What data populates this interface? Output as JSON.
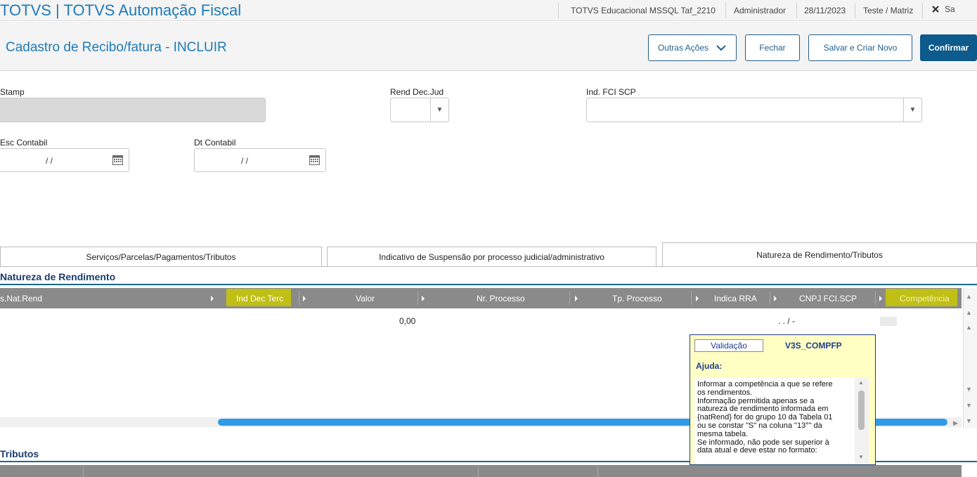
{
  "topbar": {
    "app_title": "TOTVS | TOTVS Automação Fiscal",
    "environment": "TOTVS Educacional MSSQL Taf_2210",
    "user": "Administrador",
    "date": "28/11/2023",
    "branch": "Teste / Matriz",
    "exit_label": "Sa"
  },
  "header": {
    "title": "Cadastro de Recibo/fatura - INCLUIR",
    "buttons": {
      "more_actions": "Outras Ações",
      "close": "Fechar",
      "save_new": "Salvar e Criar Novo",
      "confirm": "Confirmar"
    }
  },
  "form": {
    "stamp_label": "Stamp",
    "rend_dec_jud_label": "Rend Dec.Jud",
    "ind_fci_scp_label": "Ind. FCI SCP",
    "esc_contabil_label": "Esc Contabil",
    "esc_contabil_value": "/ /",
    "dt_contabil_label": "Dt Contabil",
    "dt_contabil_value": "/ /"
  },
  "tabs": [
    {
      "label": "Serviços/Parcelas/Pagamentos/Tributos",
      "active": false
    },
    {
      "label": "Indicativo de Suspensão por processo judicial/administrativo",
      "active": false
    },
    {
      "label": "Natureza de Rendimento/Tributos",
      "active": true
    }
  ],
  "natureza": {
    "title": "Natureza de Rendimento",
    "columns": [
      "s.Nat.Rend",
      "Ind Dec Terc",
      "Valor",
      "Nr. Processo",
      "Tp. Processo",
      "Indica RRA",
      "CNPJ FCI.SCP",
      "Competência"
    ],
    "row": {
      "valor": "0,00",
      "cnpj": ".  .  /  -"
    }
  },
  "tributos": {
    "title": "Tributos"
  },
  "tooltip": {
    "button": "Validação",
    "code": "V3S_COMPFP",
    "help_label": "Ajuda:",
    "text": "Informar a competência a que se refere\nos rendimentos.\nInformação permitida apenas se a\nnatureza de rendimento informada em\n{natRend} for do grupo 10 da Tabela 01\nou se constar \"S\" na coluna \"13°\" da\nmesma tabela.\nSe informado, não pode ser superior à\ndata atual e deve estar no formato:"
  },
  "colors": {
    "accent": "#1e7ab8",
    "primary_button": "#0d5a8c",
    "grid_header": "#8a8a8a",
    "highlight": "#c8c800",
    "tooltip_bg": "#ffffc4"
  }
}
